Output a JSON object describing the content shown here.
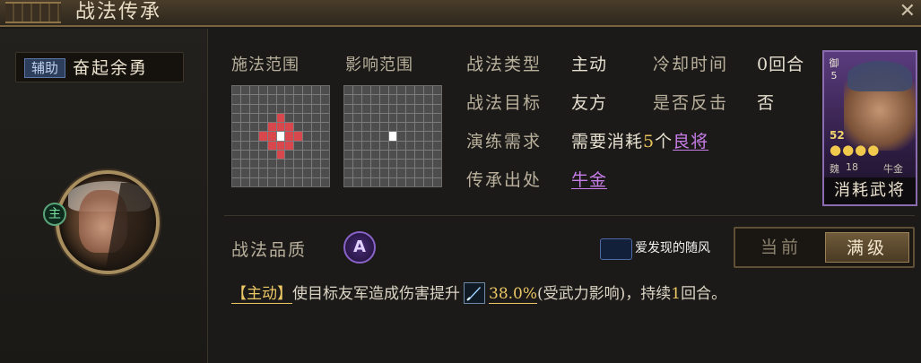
{
  "window": {
    "title": "战法传承"
  },
  "skill": {
    "type_tag": "辅助",
    "name": "奋起余勇",
    "main_badge": "主",
    "quality_label": "战法品质",
    "quality_grade": "A"
  },
  "ranges": {
    "cast_label": "施法范围",
    "effect_label": "影响范围"
  },
  "info": {
    "type_label": "战法类型",
    "type_value": "主动",
    "cooldown_label": "冷却时间",
    "cooldown_value": "0回合",
    "target_label": "战法目标",
    "target_value": "友方",
    "counter_label": "是否反击",
    "counter_value": "否",
    "train_label": "演练需求",
    "train_prefix": "需要消耗",
    "train_count": "5",
    "train_unit": "个",
    "train_link": "良将",
    "origin_label": "传承出处",
    "origin_value": "牛金"
  },
  "card": {
    "side_a": "御",
    "side_b": "5",
    "cost": "52",
    "stars": "●●●●",
    "faction": "魏",
    "level": "18",
    "name": "牛金",
    "caption": "消耗武将"
  },
  "watermark": {
    "logo_text": "爱发现的随风",
    "text": "爱发现的随风"
  },
  "toggle": {
    "current": "当前",
    "max": "满级"
  },
  "description": {
    "tag": "【主动】",
    "part1": "使目标友军造成伤害提升",
    "percent": "38.0%",
    "part2": "(受武力影响)，持续",
    "rounds": "1",
    "part3": "回合。"
  },
  "colors": {
    "range_highlight": "#d8474b",
    "self_cell": "#ffffff",
    "gold_text": "#ecc766",
    "purple_link": "#c77de8"
  }
}
